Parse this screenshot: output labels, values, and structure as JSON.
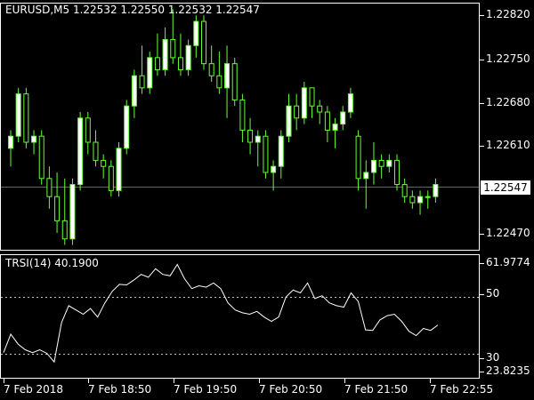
{
  "window": {
    "title": "EURUSD,M5  1.22532 1.22550 1.22532 1.22547"
  },
  "price_axis": {
    "labels": [
      "1.22820",
      "1.22750",
      "1.22680",
      "1.22610",
      "1.22470"
    ],
    "current_price": "1.22547"
  },
  "indicator": {
    "title": "TRSI(14) 40.1900",
    "axis_labels": [
      "61.9774",
      "50",
      "30",
      "23.8235"
    ]
  },
  "time_axis": {
    "labels": [
      "7 Feb 2018",
      "7 Feb 18:50",
      "7 Feb 19:50",
      "7 Feb 20:50",
      "7 Feb 21:50",
      "7 Feb 22:55"
    ]
  },
  "colors": {
    "background": "#000000",
    "bull_candle": "#ffffff",
    "bear_candle": "#000000",
    "wick": "#66ff33",
    "line": "#ffffff",
    "grid": "#ffffff"
  },
  "chart_data": [
    {
      "type": "candlestick",
      "title": "EURUSD,M5",
      "ylim": [
        1.22442,
        1.22851
      ],
      "candles": [
        [
          1.2261,
          1.2264,
          1.2258,
          1.2263
        ],
        [
          1.2263,
          1.2271,
          1.2262,
          1.227
        ],
        [
          1.227,
          1.2271,
          1.2261,
          1.2262
        ],
        [
          1.2262,
          1.2264,
          1.226,
          1.2263
        ],
        [
          1.2263,
          1.2264,
          1.2255,
          1.2256
        ],
        [
          1.2256,
          1.2258,
          1.2251,
          1.2253
        ],
        [
          1.2253,
          1.2257,
          1.2247,
          1.2249
        ],
        [
          1.2249,
          1.2256,
          1.2245,
          1.2246
        ],
        [
          1.2246,
          1.2256,
          1.2245,
          1.2255
        ],
        [
          1.2255,
          1.2267,
          1.2254,
          1.2266
        ],
        [
          1.2266,
          1.2267,
          1.226,
          1.2262
        ],
        [
          1.2262,
          1.2264,
          1.2258,
          1.2259
        ],
        [
          1.2259,
          1.226,
          1.2256,
          1.2258
        ],
        [
          1.2258,
          1.2259,
          1.2253,
          1.2254
        ],
        [
          1.2254,
          1.2262,
          1.2253,
          1.2261
        ],
        [
          1.2261,
          1.2269,
          1.226,
          1.2268
        ],
        [
          1.2268,
          1.2274,
          1.2266,
          1.2273
        ],
        [
          1.2273,
          1.2278,
          1.227,
          1.2271
        ],
        [
          1.2271,
          1.2277,
          1.227,
          1.2276
        ],
        [
          1.2276,
          1.228,
          1.2273,
          1.2274
        ],
        [
          1.2274,
          1.2281,
          1.2273,
          1.2279
        ],
        [
          1.2279,
          1.2284,
          1.2275,
          1.2276
        ],
        [
          1.2276,
          1.228,
          1.2273,
          1.2274
        ],
        [
          1.2274,
          1.2279,
          1.2273,
          1.2278
        ],
        [
          1.2278,
          1.2283,
          1.2276,
          1.2282
        ],
        [
          1.2282,
          1.2283,
          1.2274,
          1.2275
        ],
        [
          1.2275,
          1.2278,
          1.2272,
          1.2273
        ],
        [
          1.2273,
          1.2277,
          1.227,
          1.2271
        ],
        [
          1.2271,
          1.2278,
          1.2266,
          1.2275
        ],
        [
          1.2275,
          1.2276,
          1.2268,
          1.2269
        ],
        [
          1.2269,
          1.227,
          1.2262,
          1.2264
        ],
        [
          1.2264,
          1.2266,
          1.226,
          1.2262
        ],
        [
          1.2262,
          1.2264,
          1.2258,
          1.2263
        ],
        [
          1.2263,
          1.2264,
          1.2256,
          1.2257
        ],
        [
          1.2257,
          1.2259,
          1.2254,
          1.2258
        ],
        [
          1.2258,
          1.2264,
          1.2256,
          1.2263
        ],
        [
          1.2263,
          1.227,
          1.2262,
          1.2268
        ],
        [
          1.2268,
          1.227,
          1.2264,
          1.2266
        ],
        [
          1.2266,
          1.2272,
          1.2265,
          1.2271
        ],
        [
          1.2271,
          1.2271,
          1.2266,
          1.2268
        ],
        [
          1.2268,
          1.2269,
          1.2265,
          1.2267
        ],
        [
          1.2267,
          1.2268,
          1.2262,
          1.2264
        ],
        [
          1.2264,
          1.2266,
          1.2261,
          1.2265
        ],
        [
          1.2265,
          1.2268,
          1.2264,
          1.2267
        ],
        [
          1.2267,
          1.2271,
          1.2266,
          1.227
        ],
        [
          1.2263,
          1.2264,
          1.2254,
          1.2256
        ],
        [
          1.2256,
          1.2259,
          1.2251,
          1.2257
        ],
        [
          1.2257,
          1.2262,
          1.2255,
          1.2259
        ],
        [
          1.2259,
          1.226,
          1.2256,
          1.2258
        ],
        [
          1.2258,
          1.226,
          1.2257,
          1.2259
        ],
        [
          1.2259,
          1.226,
          1.2254,
          1.2255
        ],
        [
          1.2255,
          1.2256,
          1.2252,
          1.2253
        ],
        [
          1.2253,
          1.2254,
          1.2251,
          1.2252
        ],
        [
          1.2252,
          1.2254,
          1.225,
          1.2253
        ],
        [
          1.2253,
          1.2254,
          1.2251,
          1.2253
        ],
        [
          1.2253,
          1.2256,
          1.2252,
          1.2255
        ]
      ]
    },
    {
      "type": "line",
      "title": "TRSI(14)",
      "ylim": [
        23.8235,
        61.9774
      ],
      "levels": [
        50,
        30
      ],
      "values": [
        30.5,
        37,
        33.5,
        31.5,
        30.5,
        31.5,
        30.2,
        27.2,
        41,
        47,
        45.5,
        44,
        46,
        43,
        48,
        52,
        54.5,
        54.3,
        56,
        58,
        57,
        60,
        58,
        57.5,
        61.5,
        56.5,
        53,
        54,
        53.5,
        55,
        53,
        48,
        45.5,
        44.5,
        44,
        45,
        43,
        41.5,
        43,
        50,
        52.5,
        51.5,
        55,
        49.5,
        50.5,
        48,
        47,
        46.5,
        51.5,
        48.5,
        38.5,
        38.3,
        42,
        43.5,
        44,
        41.5,
        38,
        36.5,
        39,
        38.3,
        40.2
      ]
    }
  ]
}
